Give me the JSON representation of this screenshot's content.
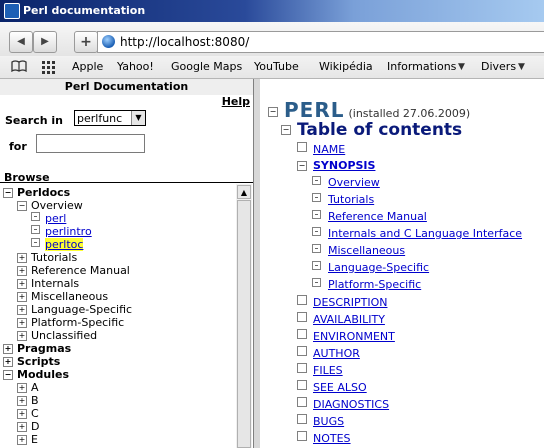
{
  "window": {
    "title": "Perl documentation"
  },
  "browser": {
    "back_label": "◀",
    "forward_label": "▶",
    "new_tab_label": "+",
    "url": "http://localhost:8080/",
    "bookmarks": [
      {
        "label": "Apple"
      },
      {
        "label": "Yahoo!"
      },
      {
        "label": "Google Maps"
      },
      {
        "label": "YouTube"
      },
      {
        "label": "Wikipédia"
      },
      {
        "label": "Informations",
        "menu": true
      },
      {
        "label": "Divers",
        "menu": true
      }
    ],
    "chevron": "▼"
  },
  "left": {
    "header": "Perl Documentation",
    "help": "Help",
    "search_label": "Search in",
    "search_value": "perlfunc",
    "select_arrow": "▼",
    "for_label": "for",
    "for_value": "",
    "browse_label": "Browse",
    "tree": [
      {
        "label": "Perldocs",
        "toggle": "−",
        "bold": true
      },
      {
        "label": "Overview",
        "toggle": "−"
      },
      {
        "label": "perl",
        "link": true
      },
      {
        "label": "perlintro",
        "link": true
      },
      {
        "label": "perltoc",
        "link": true,
        "highlight": true
      },
      {
        "label": "Tutorials",
        "toggle": "+"
      },
      {
        "label": "Reference Manual",
        "toggle": "+"
      },
      {
        "label": "Internals",
        "toggle": "+"
      },
      {
        "label": "Miscellaneous",
        "toggle": "+"
      },
      {
        "label": "Language-Specific",
        "toggle": "+"
      },
      {
        "label": "Platform-Specific",
        "toggle": "+"
      },
      {
        "label": "Unclassified",
        "toggle": "+"
      },
      {
        "label": "Pragmas",
        "toggle": "+",
        "bold": true
      },
      {
        "label": "Scripts",
        "toggle": "+",
        "bold": true
      },
      {
        "label": "Modules",
        "toggle": "−",
        "bold": true
      },
      {
        "label": "A",
        "toggle": "+"
      },
      {
        "label": "B",
        "toggle": "+"
      },
      {
        "label": "C",
        "toggle": "+"
      },
      {
        "label": "D",
        "toggle": "+"
      },
      {
        "label": "E",
        "toggle": "+"
      }
    ],
    "scroll_up": "▲"
  },
  "right": {
    "perl_toggle": "−",
    "perl_title": "PERL",
    "perl_installed": "(installed 27.06.2009)",
    "toc_toggle": "−",
    "toc_title": "Table of contents",
    "items": [
      {
        "label": "NAME"
      },
      {
        "label": "SYNOPSIS",
        "toggle": "−",
        "bold": true
      },
      {
        "label": "Overview",
        "doc": true
      },
      {
        "label": "Tutorials",
        "doc": true
      },
      {
        "label": "Reference Manual",
        "doc": true
      },
      {
        "label": "Internals and C Language Interface",
        "doc": true
      },
      {
        "label": "Miscellaneous",
        "doc": true
      },
      {
        "label": "Language-Specific",
        "doc": true
      },
      {
        "label": "Platform-Specific",
        "doc": true
      },
      {
        "label": "DESCRIPTION"
      },
      {
        "label": "AVAILABILITY"
      },
      {
        "label": "ENVIRONMENT"
      },
      {
        "label": "AUTHOR"
      },
      {
        "label": "FILES"
      },
      {
        "label": "SEE ALSO"
      },
      {
        "label": "DIAGNOSTICS"
      },
      {
        "label": "BUGS"
      },
      {
        "label": "NOTES"
      }
    ]
  },
  "colors": {
    "link": "#0000cc",
    "title_blue": "#2b5d8a",
    "toc_blue": "#0a1a7a",
    "highlight": "#ffff33"
  }
}
